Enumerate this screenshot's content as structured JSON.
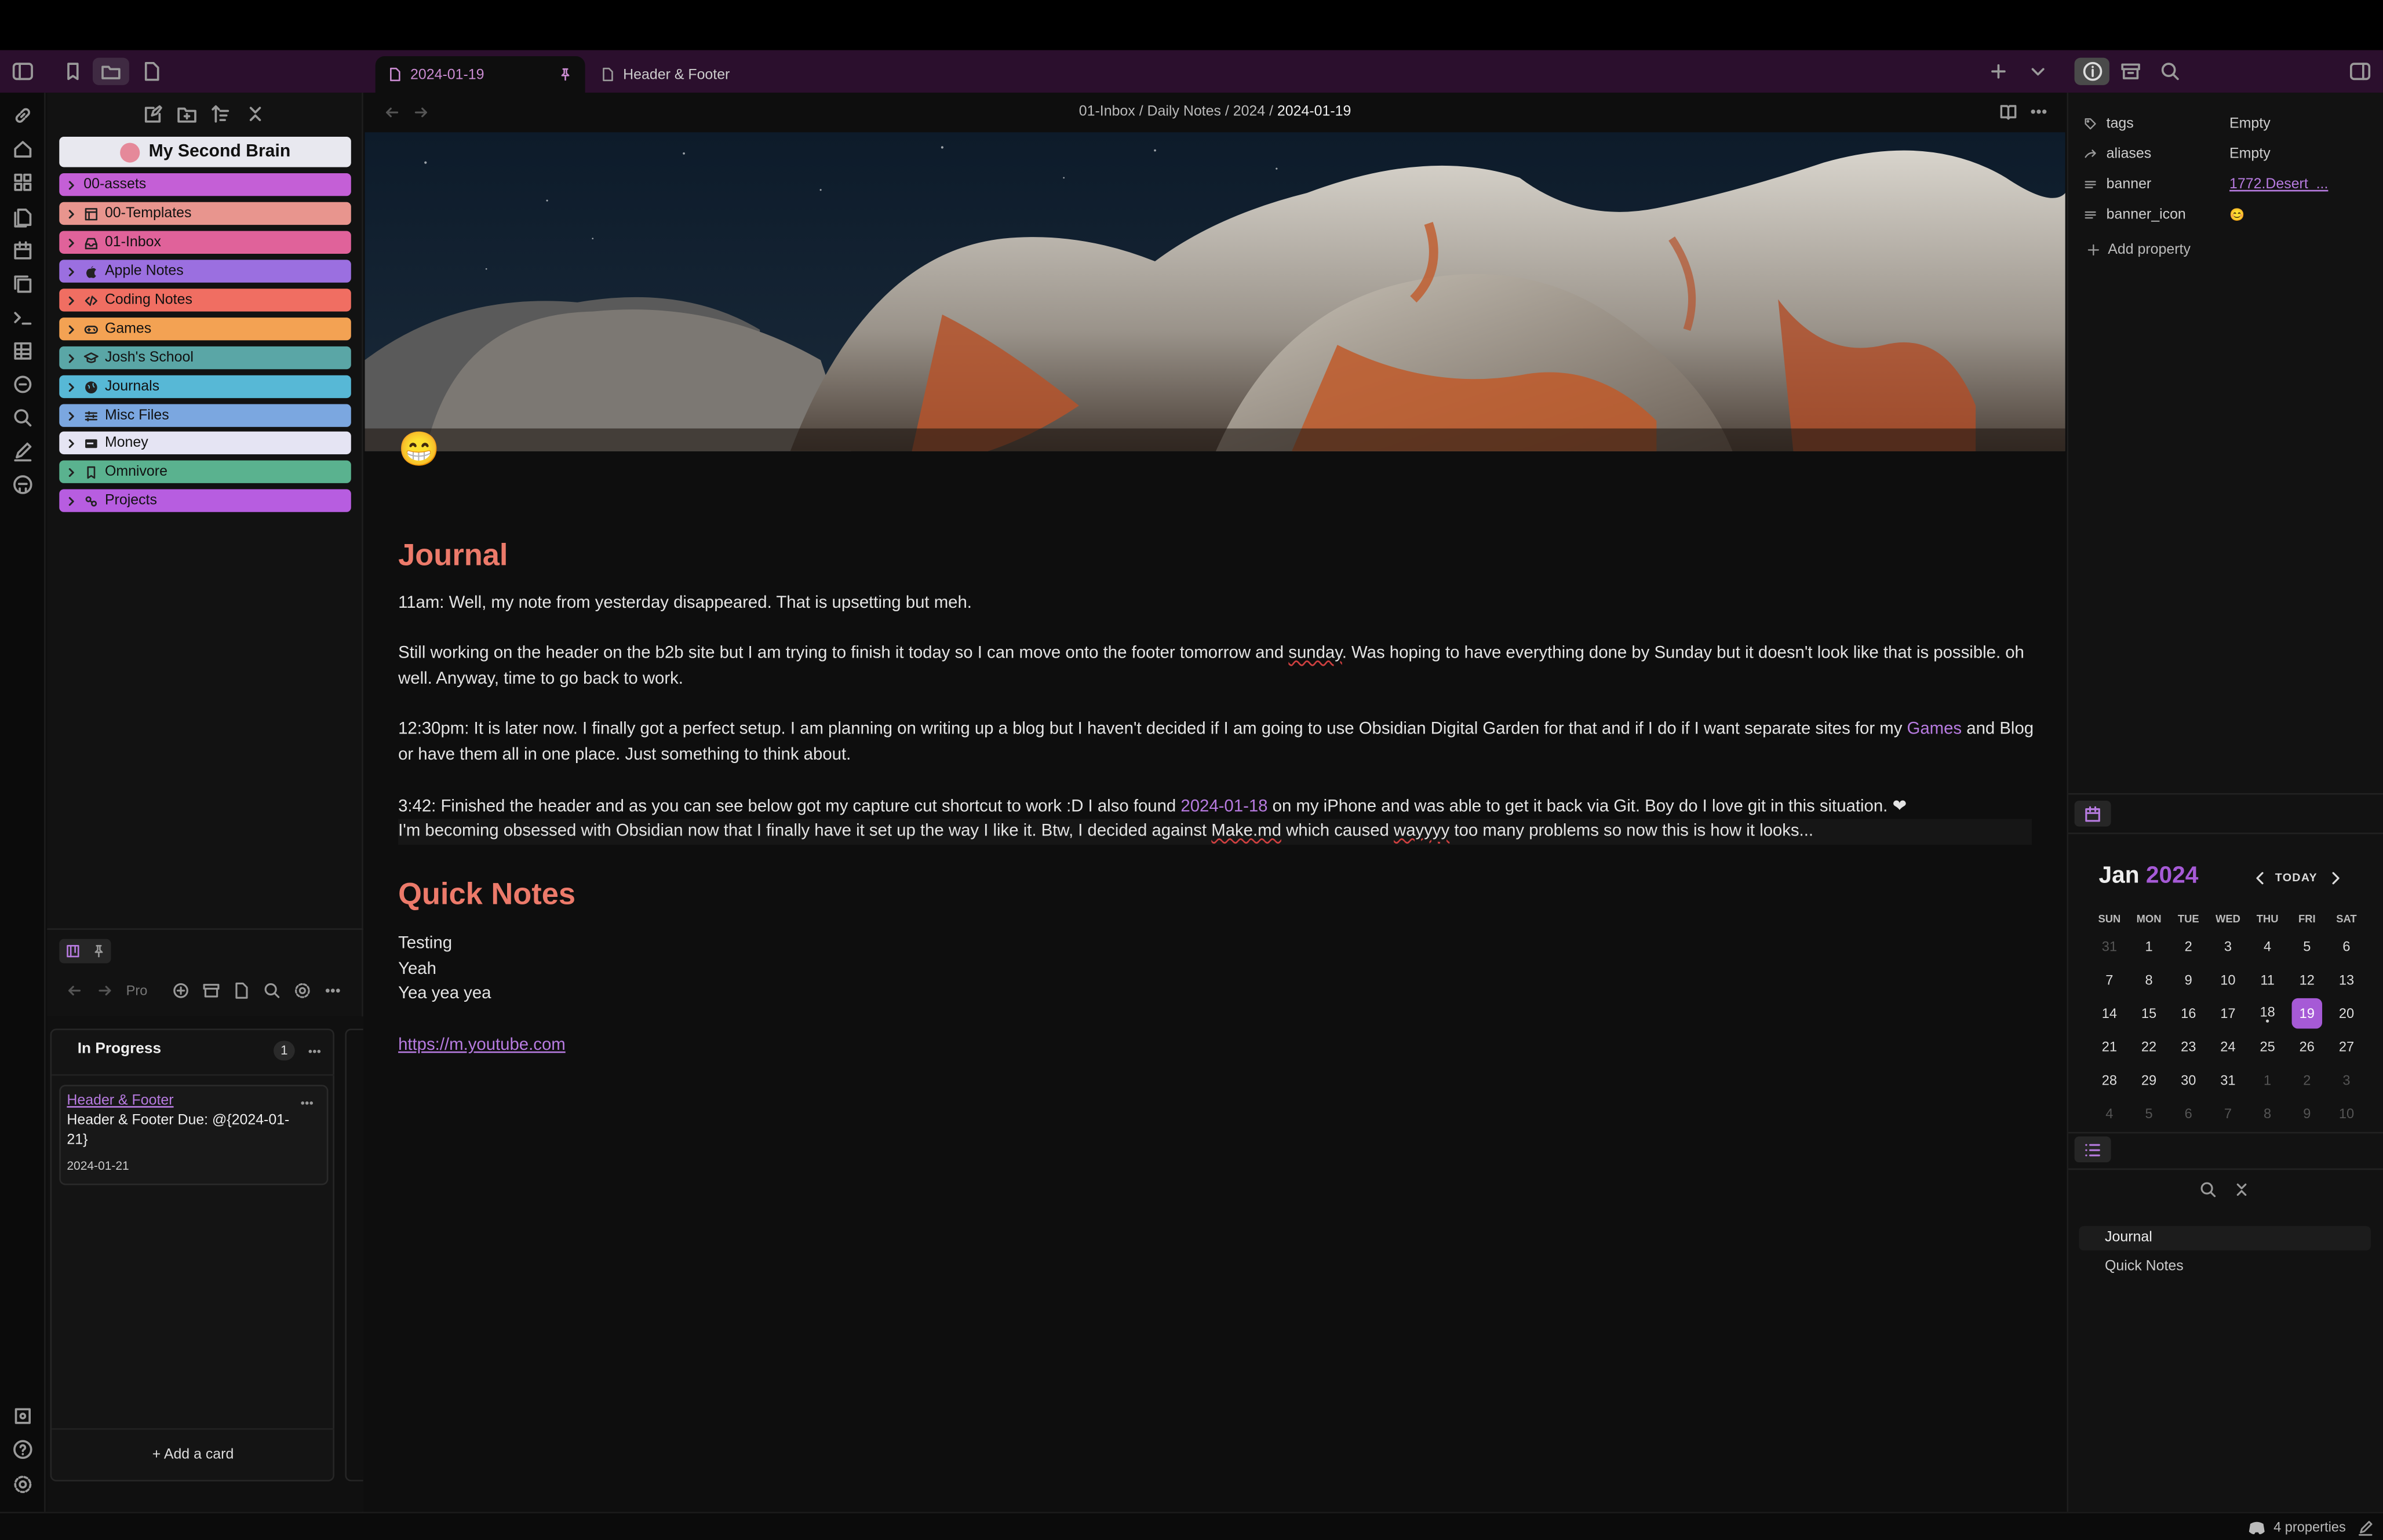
{
  "tabs": [
    {
      "label": "2024-01-19"
    },
    {
      "label": "Header & Footer"
    }
  ],
  "vault": {
    "name": "My Second Brain"
  },
  "folders": [
    {
      "label": "00-assets",
      "color": "#c45fd6",
      "icon": "chevron-icon"
    },
    {
      "label": "00-Templates",
      "color": "#e8958e",
      "icon": "template-icon"
    },
    {
      "label": "01-Inbox",
      "color": "#e0629a",
      "icon": "inbox-icon"
    },
    {
      "label": "Apple Notes",
      "color": "#9b6fe0",
      "icon": "apple-icon"
    },
    {
      "label": "Coding Notes",
      "color": "#f06e62",
      "icon": "code-icon"
    },
    {
      "label": "Games",
      "color": "#f3a253",
      "icon": "gamepad-icon"
    },
    {
      "label": "Josh's School",
      "color": "#5aa6a6",
      "icon": "graduation-cap-icon"
    },
    {
      "label": "Journals",
      "color": "#57b8d6",
      "icon": "globe-icon"
    },
    {
      "label": "Misc Files",
      "color": "#7ba7e0",
      "icon": "sliders-icon"
    },
    {
      "label": "Money",
      "color": "#e5e4f3",
      "icon": "wallet-icon"
    },
    {
      "label": "Omnivore",
      "color": "#5ab28f",
      "icon": "bookmark-icon"
    },
    {
      "label": "Projects",
      "color": "#b75de0",
      "icon": "link-icon"
    }
  ],
  "kanban": {
    "nav_label": "Pro",
    "column_title": "In Progress",
    "column_count": "1",
    "card_link": "Header & Footer",
    "card_text": "Header & Footer Due: @{2024-01-21}",
    "card_date": "2024-01-21",
    "add_card": "+ Add a card"
  },
  "breadcrumb": {
    "p1": "01-Inbox",
    "p2": "Daily Notes",
    "p3": "2024",
    "p4": "2024-01-19",
    "sep": "/"
  },
  "note": {
    "banner_emoji": "😁",
    "h_journal": "Journal",
    "p1": "11am: Well, my note from yesterday disappeared. That is upsetting but meh.",
    "p2a": "Still working on the header on the b2b site but I am trying to finish it today so I can move onto the footer tomorrow and ",
    "p2b": "sunday",
    "p2c": ". Was hoping to have everything done by Sunday but it doesn't look like that is possible. oh well. Anyway, time to go back to work.",
    "p3a": "12:30pm: It is later now. I finally got a perfect setup. I am planning on writing up a blog but I haven't decided if I am going to use Obsidian Digital Garden for that and if I do if I want separate sites for my ",
    "p3link": "Games",
    "p3b": " and Blog or have them all in one place. Just something to think about.",
    "p4a": "3:42: Finished the header and as you can see below got my capture cut shortcut to work :D I also found ",
    "p4link": "2024-01-18",
    "p4b": " on my iPhone and was able to get it back via Git. Boy do I love git in this situation. ❤",
    "p5a": "I'm becoming obsessed with Obsidian now that I finally have it set up the way I like it. Btw, I decided against ",
    "p5b": "Make.md",
    "p5c": " which caused ",
    "p5d": "wayyyy",
    "p5e": " too many problems so now this is how it looks...",
    "h_quick": "Quick Notes",
    "q1": "Testing",
    "q2": "Yeah",
    "q3": "Yea yea yea",
    "url": "https://m.youtube.com"
  },
  "properties": [
    {
      "key": "tags",
      "value": "Empty",
      "icon": "tag-icon"
    },
    {
      "key": "aliases",
      "value": "Empty",
      "icon": "alias-icon"
    },
    {
      "key": "banner",
      "value": "1772.Desert_...",
      "icon": "text-icon"
    },
    {
      "key": "banner_icon",
      "value": "😊",
      "icon": "text-icon"
    }
  ],
  "add_property": "Add property",
  "calendar": {
    "month": "Jan",
    "year": "2024",
    "today_label": "TODAY",
    "weekdays": [
      "SUN",
      "MON",
      "TUE",
      "WED",
      "THU",
      "FRI",
      "SAT"
    ],
    "weeks": [
      [
        "31",
        "1",
        "2",
        "3",
        "4",
        "5",
        "6"
      ],
      [
        "7",
        "8",
        "9",
        "10",
        "11",
        "12",
        "13"
      ],
      [
        "14",
        "15",
        "16",
        "17",
        "18",
        "19",
        "20"
      ],
      [
        "21",
        "22",
        "23",
        "24",
        "25",
        "26",
        "27"
      ],
      [
        "28",
        "29",
        "30",
        "31",
        "1",
        "2",
        "3"
      ],
      [
        "4",
        "5",
        "6",
        "7",
        "8",
        "9",
        "10"
      ]
    ],
    "selected": "19"
  },
  "outline": [
    "Journal",
    "Quick Notes"
  ],
  "status": {
    "properties": "4 properties"
  },
  "colors": {
    "accent": "#a65ad6",
    "heading": "#ec7a6a",
    "tabbar": "#2b0f2d"
  }
}
